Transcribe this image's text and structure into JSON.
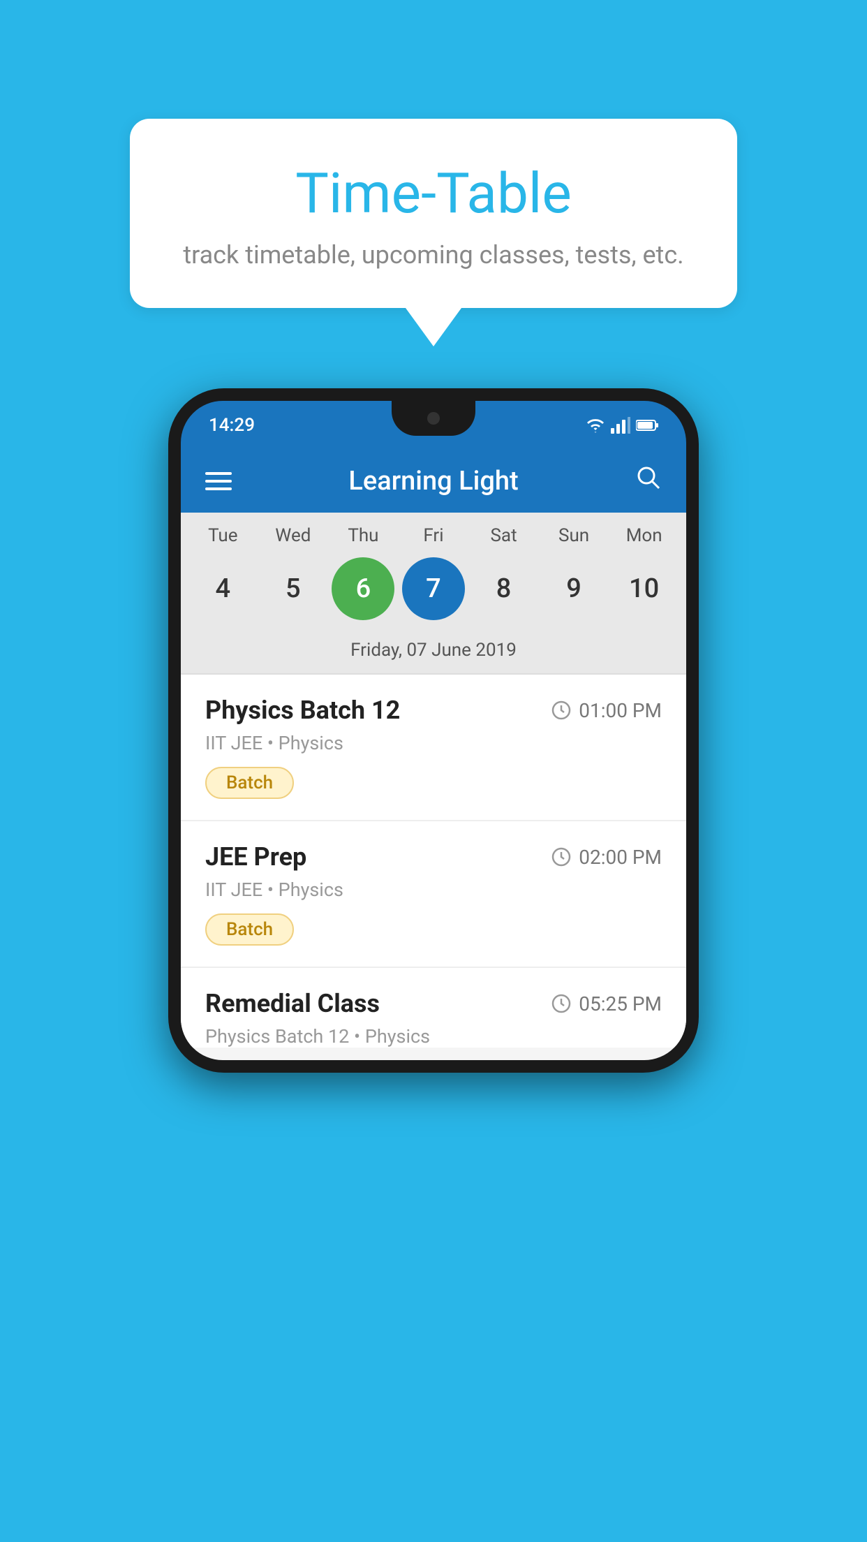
{
  "background_color": "#29B6E8",
  "speech_bubble": {
    "title": "Time-Table",
    "subtitle": "track timetable, upcoming classes, tests, etc."
  },
  "status_bar": {
    "time": "14:29",
    "icons": [
      "wifi",
      "signal",
      "battery"
    ]
  },
  "toolbar": {
    "app_name": "Learning Light"
  },
  "calendar": {
    "days": [
      "Tue",
      "Wed",
      "Thu",
      "Fri",
      "Sat",
      "Sun",
      "Mon"
    ],
    "dates": [
      "4",
      "5",
      "6",
      "7",
      "8",
      "9",
      "10"
    ],
    "today_index": 2,
    "selected_index": 3,
    "selected_date_label": "Friday, 07 June 2019"
  },
  "schedule_items": [
    {
      "title": "Physics Batch 12",
      "time": "01:00 PM",
      "subtitle": "IIT JEE • Physics",
      "badge": "Batch"
    },
    {
      "title": "JEE Prep",
      "time": "02:00 PM",
      "subtitle": "IIT JEE • Physics",
      "badge": "Batch"
    },
    {
      "title": "Remedial Class",
      "time": "05:25 PM",
      "subtitle": "Physics Batch 12 • Physics",
      "badge": null
    }
  ]
}
